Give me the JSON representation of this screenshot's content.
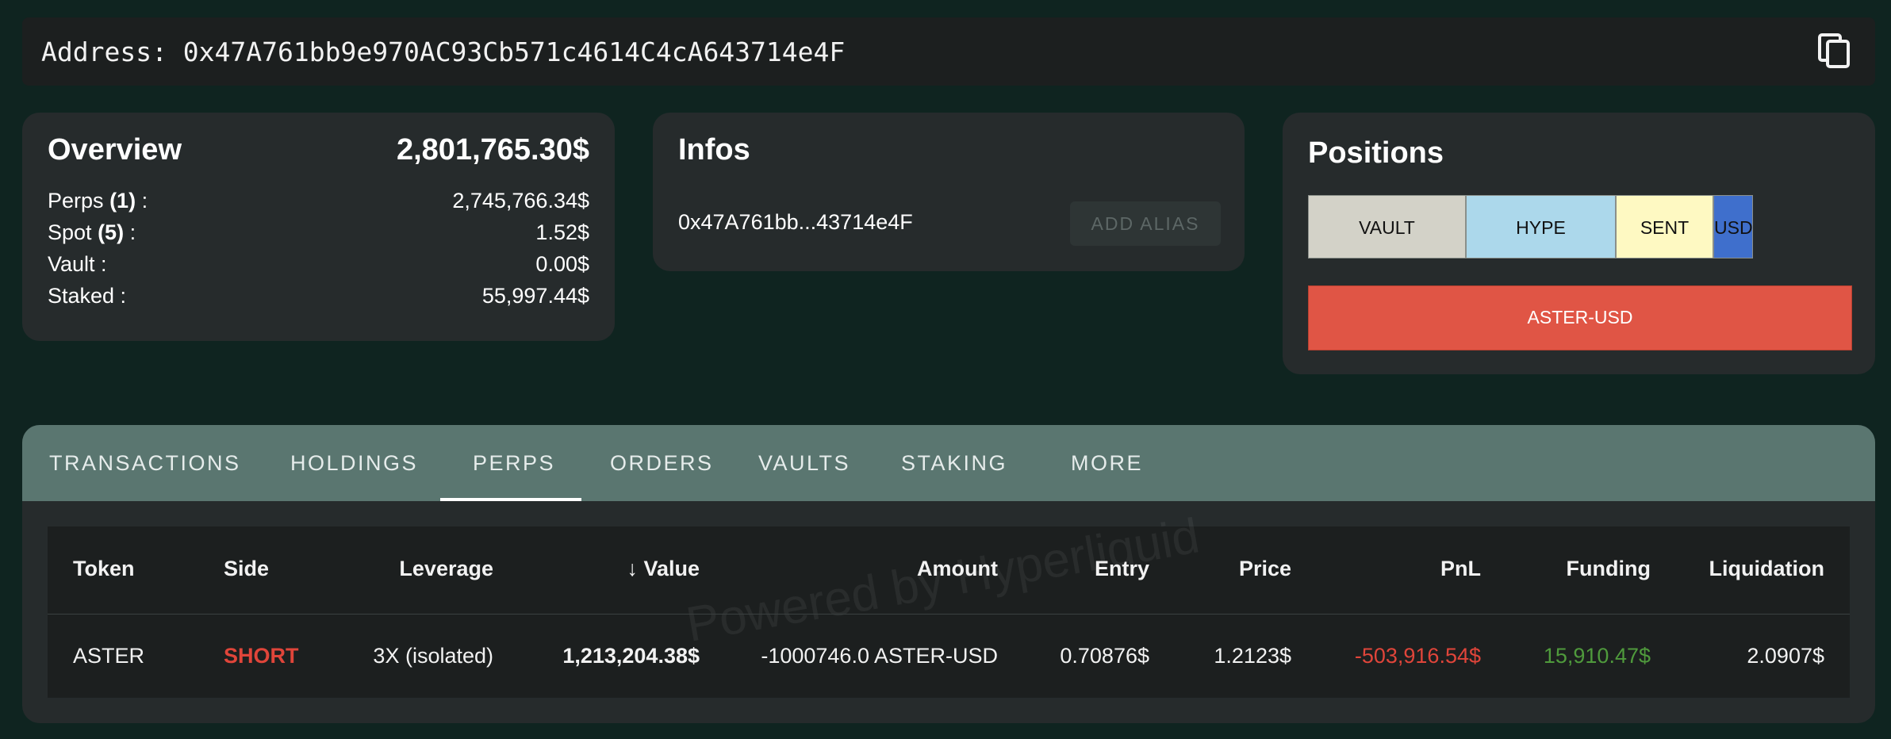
{
  "address_bar": {
    "text": "Address: 0x47A761bb9e970AC93Cb571c4614C4cA643714e4F"
  },
  "overview": {
    "title": "Overview",
    "total": "2,801,765.30$",
    "perps_label": "Perps",
    "perps_count": "(1)",
    "perps_value": "2,745,766.34$",
    "spot_label": "Spot",
    "spot_count": "(5)",
    "spot_value": "1.52$",
    "vault_label": "Vault :",
    "vault_value": "0.00$",
    "staked_label": "Staked :",
    "staked_value": "55,997.44$",
    "colon": " :"
  },
  "infos": {
    "title": "Infos",
    "short_address": "0x47A761bb...43714e4F",
    "add_alias": "ADD ALIAS"
  },
  "positions": {
    "title": "Positions",
    "holdings": [
      {
        "label": "VAULT",
        "color": "#d3d2c8",
        "share": 0.29
      },
      {
        "label": "HYPE",
        "color": "#acd8eb",
        "share": 0.275
      },
      {
        "label": "SENT",
        "color": "#fef9c2",
        "share": 0.18
      },
      {
        "label": "USDC",
        "color": "#3f6fcc",
        "share": 0.073
      }
    ],
    "perps": [
      {
        "label": "ASTER-USD",
        "color": "#e05545"
      }
    ]
  },
  "tabs": {
    "items": [
      "TRANSACTIONS",
      "HOLDINGS",
      "PERPS",
      "ORDERS",
      "VAULTS",
      "STAKING",
      "MORE"
    ],
    "active": "PERPS"
  },
  "table": {
    "watermark": "Powered by Hyperliquid",
    "sort_arrow": "↓",
    "headers": {
      "token": "Token",
      "side": "Side",
      "leverage": "Leverage",
      "value": "Value",
      "amount": "Amount",
      "entry": "Entry",
      "price": "Price",
      "pnl": "PnL",
      "funding": "Funding",
      "liquidation": "Liquidation"
    },
    "rows": [
      {
        "token": "ASTER",
        "side": "SHORT",
        "leverage": "3X (isolated)",
        "value": "1,213,204.38$",
        "amount": "-1000746.0 ASTER-USD",
        "entry": "0.70876$",
        "price": "1.2123$",
        "pnl": "-503,916.54$",
        "funding": "15,910.47$",
        "liquidation": "2.0907$"
      }
    ],
    "colors": {
      "short": "#e0453a",
      "pnl_negative": "#e0453a",
      "funding_positive": "#4f9a3c"
    }
  }
}
